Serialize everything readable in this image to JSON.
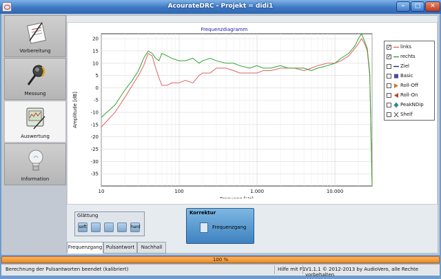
{
  "window": {
    "title": "AcourateDRC  - Projekt = didi1"
  },
  "sidebar": {
    "items": [
      {
        "label": "Vorbereitung",
        "icon": "notepad-icon"
      },
      {
        "label": "Messung",
        "icon": "microphone-icon"
      },
      {
        "label": "Auswertung",
        "icon": "chart-monitor-icon"
      },
      {
        "label": "Information",
        "icon": "lightbulb-icon"
      }
    ],
    "active_index": 2
  },
  "legend": [
    {
      "label": "links",
      "checked": true,
      "marker": "line",
      "color": "#e06060"
    },
    {
      "label": "rechts",
      "checked": true,
      "marker": "line",
      "color": "#2fa22f"
    },
    {
      "label": "Ziel",
      "checked": false,
      "marker": "line",
      "color": "#1a1a8a"
    },
    {
      "label": "Basic",
      "checked": false,
      "marker": "square",
      "color": "#4a4a9a"
    },
    {
      "label": "Roll-Off",
      "checked": false,
      "marker": "triangle-right",
      "color": "#c87a20"
    },
    {
      "label": "Roll-On",
      "checked": false,
      "marker": "triangle-left",
      "color": "#c04020"
    },
    {
      "label": "PeakNDip",
      "checked": false,
      "marker": "diamond",
      "color": "#2a8a9a"
    },
    {
      "label": "Shelf",
      "checked": false,
      "marker": "x",
      "color": "#555555"
    }
  ],
  "glaettung": {
    "title": "Glättung",
    "buttons": [
      "soft",
      "",
      "",
      "",
      "hard"
    ],
    "selected": [
      0,
      4
    ]
  },
  "korrektur": {
    "title": "Korrektur",
    "label": "Frequenzgang"
  },
  "tabs": [
    "Frequenzgang",
    "Pulsantwort",
    "Nachhall"
  ],
  "active_tab": 0,
  "progress": {
    "text": "100 %",
    "value": 1.0
  },
  "status": {
    "message": "Berechnung der Pulsantworten beendet (kalibriert)",
    "help": "Hilfe mit F1",
    "version": "V1.1.1 © 2012-2013 by AudioVero, alle Rechte vorbehalten"
  },
  "chart_data": {
    "type": "line",
    "title": "Frequenzdiagramm",
    "xlabel": "Frequenz [Hz]",
    "ylabel": "Amplitude [dB]",
    "xscale": "log",
    "xlim": [
      10,
      30000
    ],
    "ylim": [
      -40,
      22
    ],
    "xticks": [
      10,
      100,
      1000,
      10000
    ],
    "xtick_labels": [
      "10",
      "100",
      "1.000",
      "10.000"
    ],
    "yticks": [
      20,
      15,
      10,
      5,
      0,
      -5,
      -10,
      -15,
      -20,
      -25,
      -30,
      -35
    ],
    "grid": true,
    "series": [
      {
        "name": "links",
        "color": "#e06060",
        "x": [
          10,
          15,
          20,
          25,
          30,
          35,
          40,
          45,
          50,
          55,
          60,
          70,
          80,
          100,
          120,
          150,
          180,
          200,
          250,
          300,
          400,
          500,
          600,
          800,
          1000,
          1200,
          1500,
          2000,
          2500,
          3000,
          4000,
          5000,
          6000,
          8000,
          10000,
          12000,
          15000,
          18000,
          20000,
          22000,
          24000,
          26000,
          28000,
          30000
        ],
        "y": [
          -16,
          -10,
          -4,
          1,
          5,
          9,
          14,
          13,
          8,
          4,
          1,
          1,
          2,
          2,
          3,
          2,
          5,
          6,
          6,
          8,
          8,
          7,
          6,
          6,
          6,
          7,
          7,
          8,
          8,
          8,
          7,
          8,
          9,
          10,
          10,
          11,
          13,
          16,
          18,
          20,
          18,
          15,
          5,
          -40
        ]
      },
      {
        "name": "rechts",
        "color": "#2fa22f",
        "x": [
          10,
          15,
          20,
          25,
          30,
          35,
          40,
          45,
          50,
          55,
          60,
          70,
          80,
          100,
          120,
          150,
          180,
          200,
          250,
          300,
          400,
          500,
          600,
          800,
          1000,
          1200,
          1500,
          2000,
          2500,
          3000,
          4000,
          5000,
          6000,
          8000,
          10000,
          12000,
          15000,
          18000,
          20000,
          22000,
          24000,
          26000,
          28000,
          30000
        ],
        "y": [
          -12,
          -7,
          -1,
          3,
          7,
          12,
          15,
          14,
          12,
          11,
          14,
          13,
          12,
          11,
          11,
          12,
          10,
          11,
          12,
          11,
          10,
          10,
          9,
          8,
          9,
          8,
          8,
          9,
          8,
          8,
          8,
          7,
          8,
          9,
          10,
          12,
          14,
          17,
          20,
          22,
          19,
          16,
          6,
          -40
        ]
      }
    ]
  }
}
